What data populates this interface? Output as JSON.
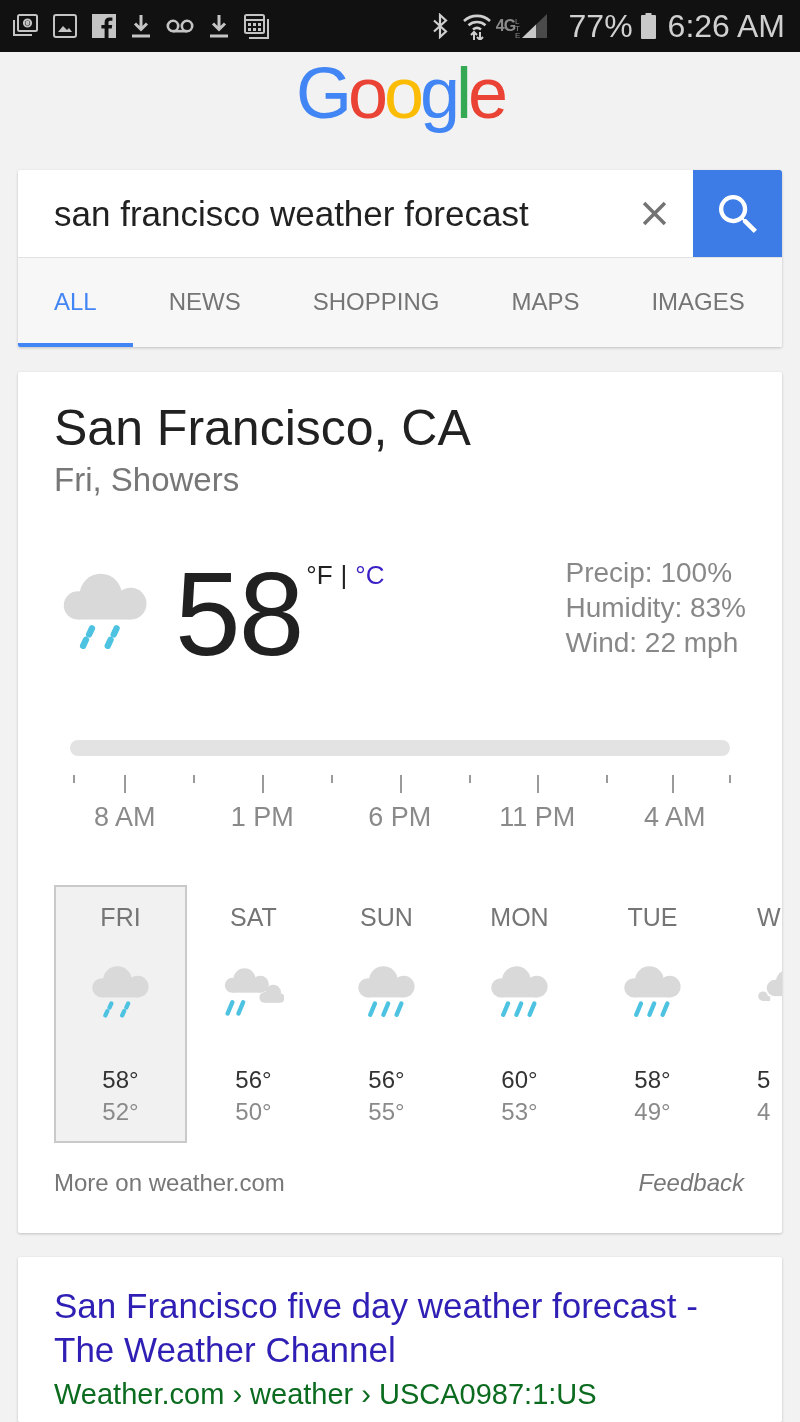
{
  "status_bar": {
    "network": "4G",
    "network_detail": "LTE",
    "battery": "77%",
    "time": "6:26 AM"
  },
  "logo": "Google",
  "search": {
    "query": "san francisco weather forecast"
  },
  "tabs": [
    {
      "label": "ALL",
      "selected": true
    },
    {
      "label": "NEWS",
      "selected": false
    },
    {
      "label": "SHOPPING",
      "selected": false
    },
    {
      "label": "MAPS",
      "selected": false
    },
    {
      "label": "IMAGES",
      "selected": false
    }
  ],
  "weather": {
    "location": "San Francisco, CA",
    "condition": "Fri, Showers",
    "current": {
      "kind": "showers",
      "temperature": "58"
    },
    "units": [
      {
        "label": "°F",
        "selected": true
      },
      {
        "label": "°C",
        "selected": false
      }
    ],
    "unit_separator": "|",
    "details": [
      "Precip: 100%",
      "Humidity: 83%",
      "Wind: 22 mph"
    ],
    "hours": [
      "8 AM",
      "1 PM",
      "6 PM",
      "11 PM",
      "4 AM"
    ],
    "days": [
      {
        "day": "FRI",
        "kind": "showers",
        "high": "58°",
        "low": "52°",
        "selected": true
      },
      {
        "day": "SAT",
        "kind": "showers_partly",
        "high": "56°",
        "low": "50°",
        "selected": false
      },
      {
        "day": "SUN",
        "kind": "rain",
        "high": "56°",
        "low": "55°",
        "selected": false
      },
      {
        "day": "MON",
        "kind": "rain",
        "high": "60°",
        "low": "53°",
        "selected": false
      },
      {
        "day": "TUE",
        "kind": "rain",
        "high": "58°",
        "low": "49°",
        "selected": false
      },
      {
        "day": "W",
        "kind": "partly_cloudy",
        "high": "5",
        "low": "4",
        "selected": false
      }
    ],
    "more_link": "More on weather.com",
    "feedback": "Feedback"
  },
  "result": {
    "title": "San Francisco five day weather forecast - The Weather Channel",
    "url": "Weather.com › weather › USCA0987:1:US"
  }
}
